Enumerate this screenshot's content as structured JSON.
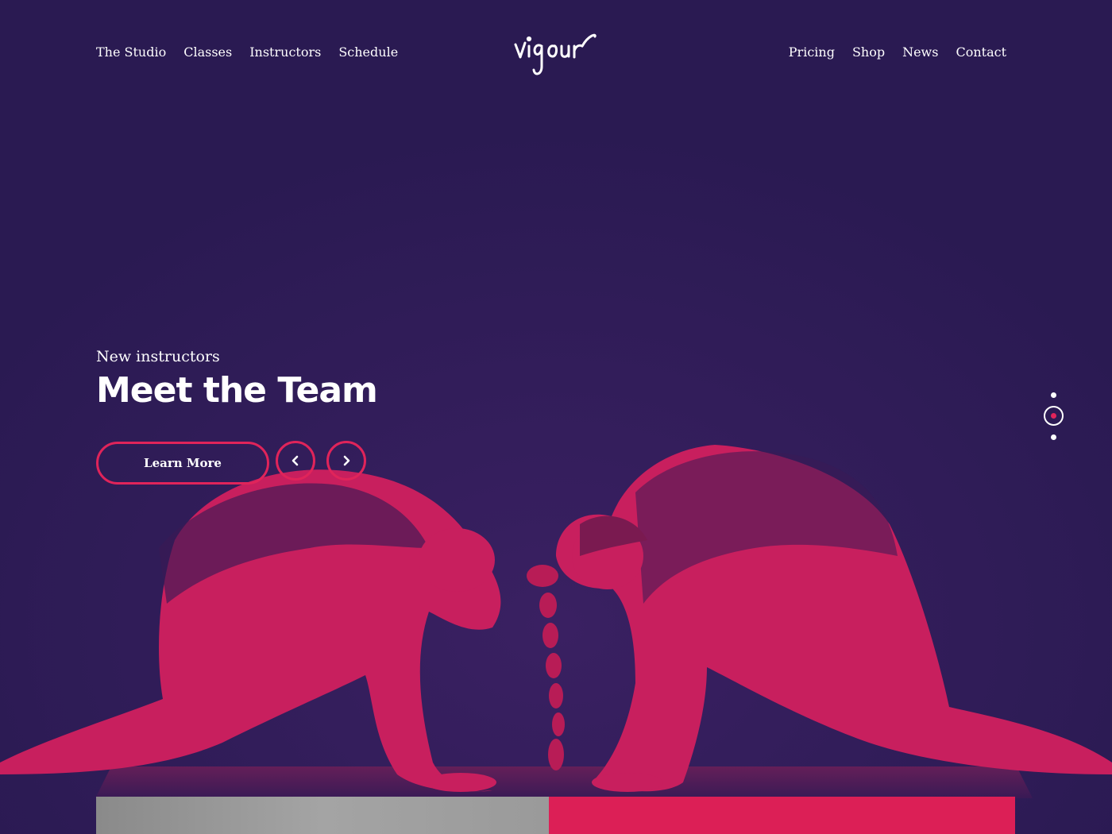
{
  "nav": {
    "left": [
      "The Studio",
      "Classes",
      "Instructors",
      "Schedule"
    ],
    "right": [
      "Pricing",
      "Shop",
      "News",
      "Contact"
    ]
  },
  "logo": {
    "text": "vigour"
  },
  "hero": {
    "eyebrow": "New instructors",
    "title": "Meet the Team",
    "cta_label": "Learn More",
    "prev_icon": "chevron-left-icon",
    "next_icon": "chevron-right-icon"
  },
  "slider": {
    "total": 3,
    "active": 2
  },
  "colors": {
    "background": "#2a1a52",
    "accent": "#e0245a",
    "text": "#ffffff"
  }
}
